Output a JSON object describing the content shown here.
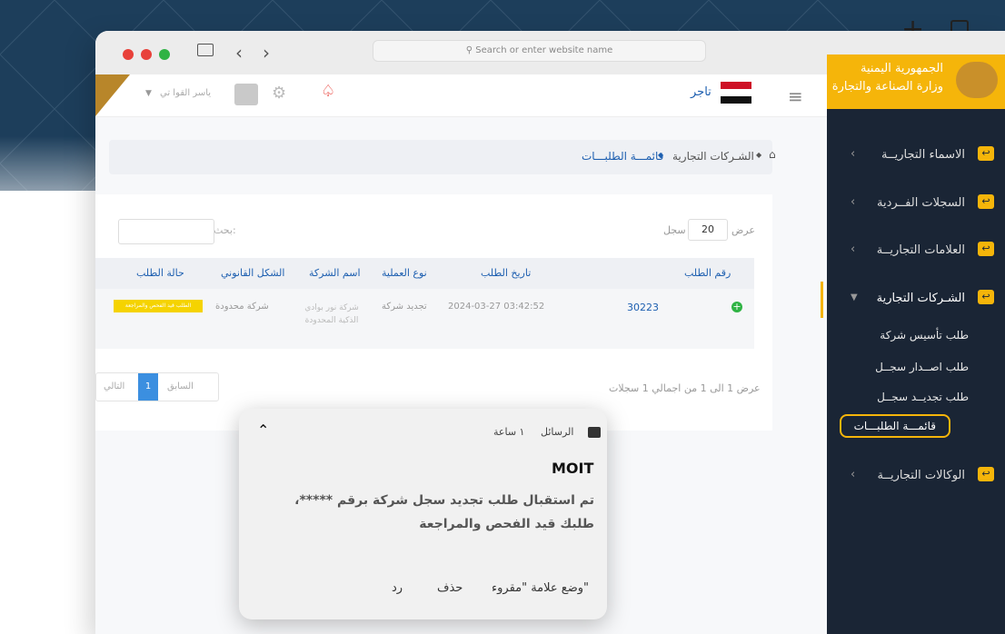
{
  "browser": {
    "url_placeholder": "Search or enter website name"
  },
  "topbar": {
    "user_name": "ياسر القوا تي",
    "role": "تاجر"
  },
  "brand": {
    "line1": "الجمهورية اليمنية",
    "line2": "وزارة الصناعة والتجارة"
  },
  "sidebar": {
    "items": [
      {
        "label": "الاسماء التجاريــة"
      },
      {
        "label": "السجلات الفــردية"
      },
      {
        "label": "العلامات التجاريــة"
      },
      {
        "label": "الشـركات التجارية"
      },
      {
        "label": "الوكالات التجاريــة"
      }
    ],
    "submenu": [
      {
        "label": "طلب تأسيس شركة"
      },
      {
        "label": "طلب اصــدار سجــل"
      },
      {
        "label": "طلب تجديــد سجــل"
      },
      {
        "label": "قائمـــة الطلبـــات"
      }
    ]
  },
  "breadcrumb": {
    "home_icon": "home-icon",
    "section": "الشـركات التجارية",
    "page": "قائمـــة الطلبـــات"
  },
  "table": {
    "show_label": "عرض",
    "page_size": "20",
    "records_label": "سجل",
    "search_label": "بحث:",
    "headers": [
      "رقم الطلب",
      "تاريخ الطلب",
      "نوع العملية",
      "اسم الشركة",
      "الشكل القانوني",
      "حالة الطلب"
    ],
    "rows": [
      {
        "request_no": "30223",
        "date": "2024-03-27 03:42:52",
        "operation": "تجديد شركة",
        "company": "شركة نور بوادي الذكية المحدودة",
        "legal_form": "شركة محدودة",
        "status": "الطلب قيد الفحص والمراجعة"
      }
    ],
    "info": "عرض 1 الى 1 من اجمالي 1 سجلات",
    "prev": "السابق",
    "page": "1",
    "next": "التالي"
  },
  "notification": {
    "app": "الرسائل",
    "time": "١ ساعة",
    "sender": "MOIT",
    "body_line1": "تم استقبال طلب تجديد سجل شركة برقم *****،",
    "body_line2": "طلبك قيد الفحص والمراجعة",
    "actions": {
      "mark_read": "وضع علامة \"مقروء\"",
      "delete": "حذف",
      "reply": "رد"
    }
  },
  "colors": {
    "accent": "#f5b50a",
    "navy": "#1a2535",
    "link": "#1d5fb0",
    "status_badge": "#f5d300",
    "add": "#2fb344"
  }
}
